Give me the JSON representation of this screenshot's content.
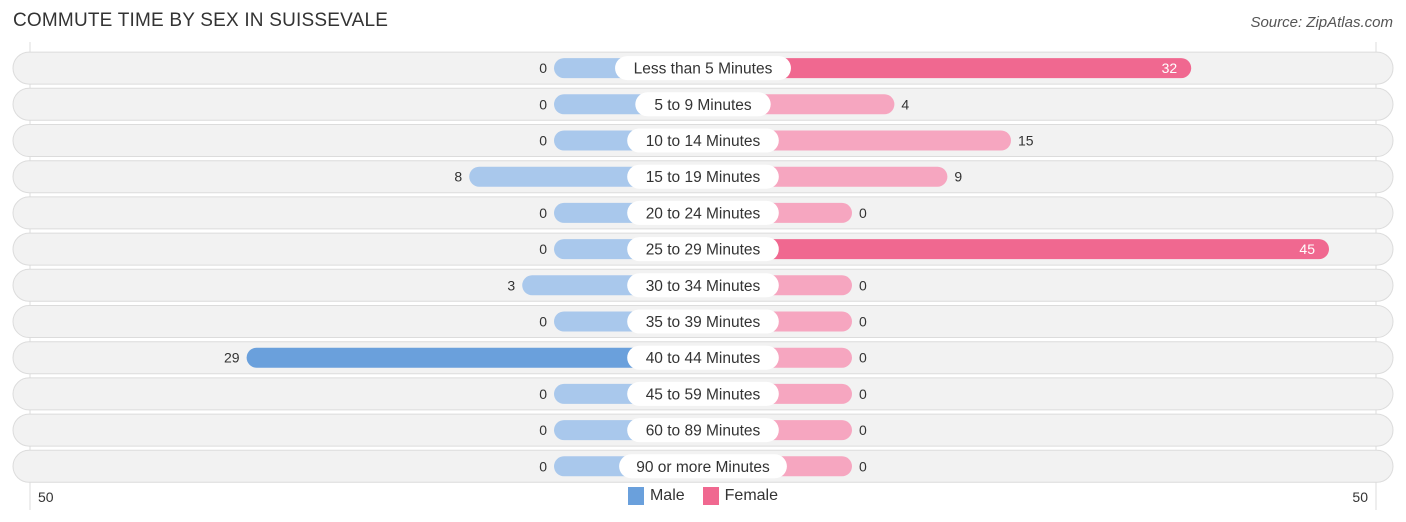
{
  "header": {
    "title": "COMMUTE TIME BY SEX IN SUISSEVALE",
    "source": "Source: ZipAtlas.com"
  },
  "colors": {
    "male": "#6aa0dc",
    "male_light": "#a9c8ec",
    "female": "#f06890",
    "female_light": "#f6a6c0",
    "track": "#f2f2f2"
  },
  "chart_data": {
    "type": "bar",
    "orientation": "horizontal-diverging",
    "title": "COMMUTE TIME BY SEX IN SUISSEVALE",
    "categories": [
      "Less than 5 Minutes",
      "5 to 9 Minutes",
      "10 to 14 Minutes",
      "15 to 19 Minutes",
      "20 to 24 Minutes",
      "25 to 29 Minutes",
      "30 to 34 Minutes",
      "35 to 39 Minutes",
      "40 to 44 Minutes",
      "45 to 59 Minutes",
      "60 to 89 Minutes",
      "90 or more Minutes"
    ],
    "series": [
      {
        "name": "Male",
        "values": [
          0,
          0,
          0,
          8,
          0,
          0,
          3,
          0,
          29,
          0,
          0,
          0
        ]
      },
      {
        "name": "Female",
        "values": [
          32,
          4,
          15,
          9,
          0,
          45,
          0,
          0,
          0,
          0,
          0,
          0
        ]
      }
    ],
    "axis": {
      "left_label": "50",
      "right_label": "50",
      "range": [
        -50,
        50
      ]
    },
    "legend": {
      "position": "bottom-center",
      "entries": [
        "Male",
        "Female"
      ]
    }
  }
}
